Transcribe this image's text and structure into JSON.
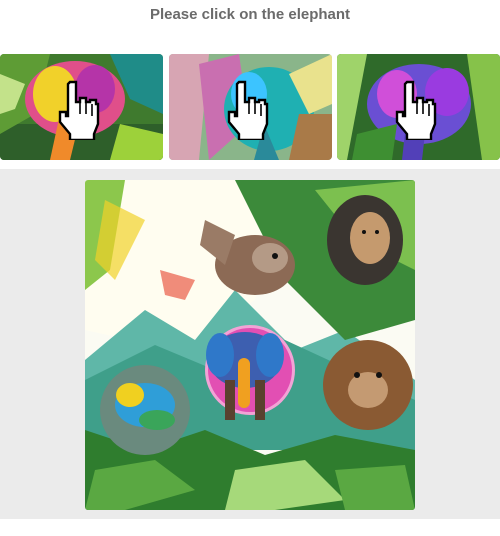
{
  "prompt": "Please click on the elephant",
  "tiles": [
    {
      "icon": "pointer-hand-icon"
    },
    {
      "icon": "pointer-hand-icon"
    },
    {
      "icon": "pointer-hand-icon"
    }
  ],
  "colors": {
    "prompt_text": "#6b6b6b",
    "panel_bg": "#ebebeb",
    "accent": "#3aa79a"
  }
}
